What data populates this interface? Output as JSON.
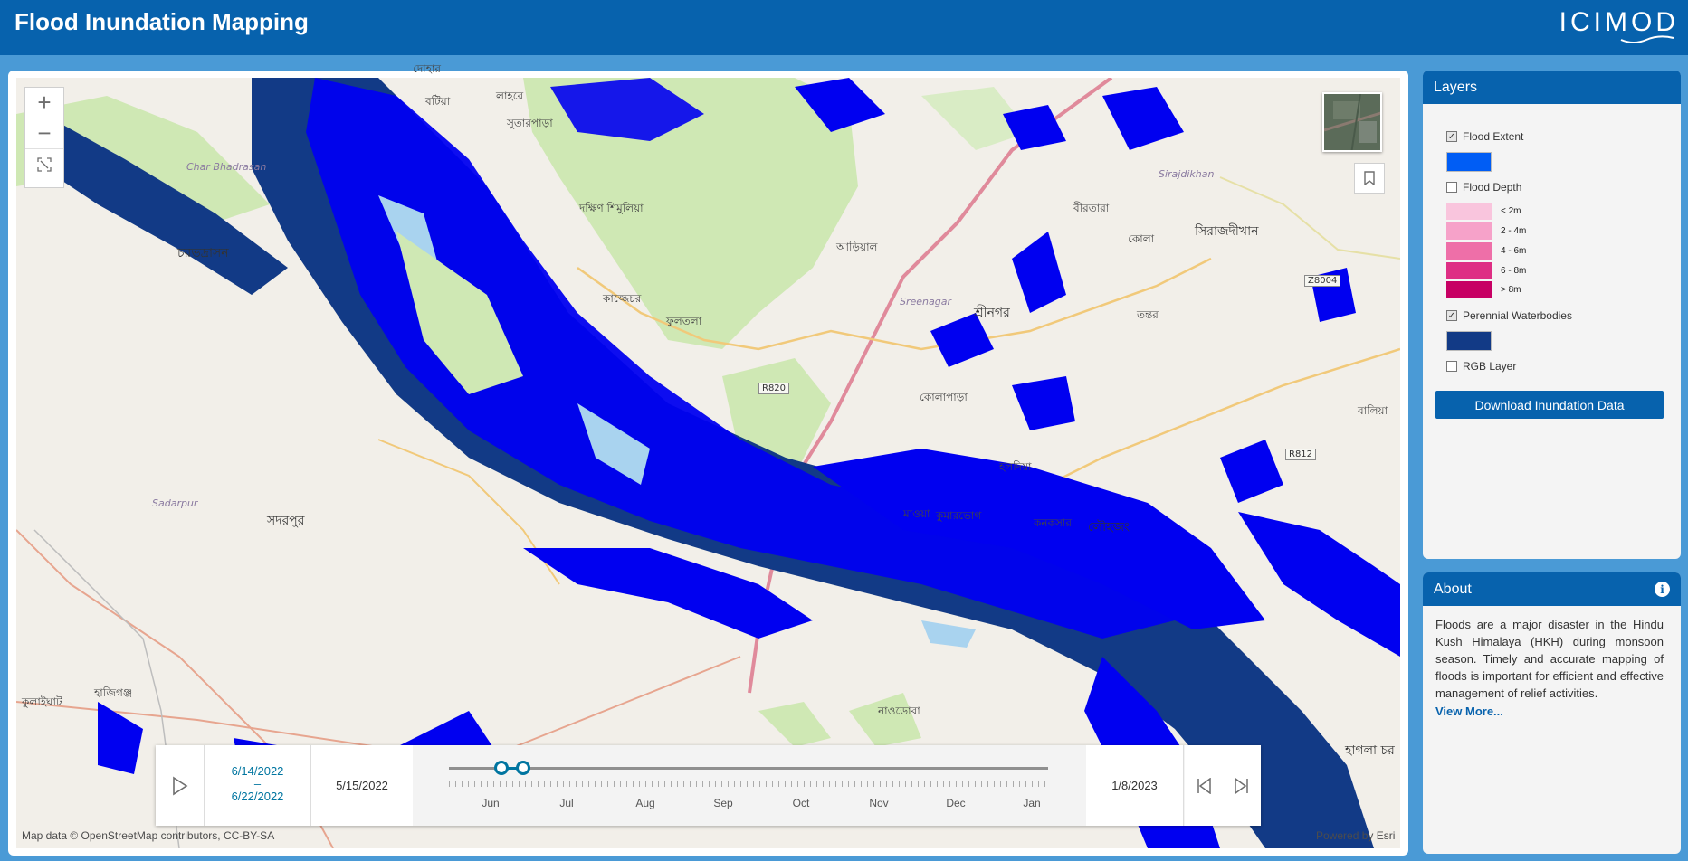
{
  "header": {
    "title": "Flood Inundation Mapping",
    "logo_text": "ICIMOD"
  },
  "map": {
    "attribution": "Map data © OpenStreetMap contributors, CC-BY-SA",
    "powered_by": "Powered by Esri",
    "zoom_in": "+",
    "zoom_out": "−",
    "places": [
      {
        "name": "দোহার",
        "big": false
      },
      {
        "name": "বটিয়া",
        "big": false
      },
      {
        "name": "সুতারপাড়া",
        "big": false
      },
      {
        "name": "লাহরে",
        "big": false
      },
      {
        "name": "দক্ষিণ শিমুলিয়া",
        "big": false
      },
      {
        "name": "চরভদ্রাসন",
        "big": true
      },
      {
        "name": "কাজ্জেচর",
        "big": false
      },
      {
        "name": "ফুলতলা",
        "big": false
      },
      {
        "name": "আড়িয়াল",
        "big": false
      },
      {
        "name": "শ্রীনগর",
        "big": true
      },
      {
        "name": "সিরাজদীখান",
        "big": true
      },
      {
        "name": "বীরতারা",
        "big": false
      },
      {
        "name": "কোলা",
        "big": false
      },
      {
        "name": "তন্তর",
        "big": false
      },
      {
        "name": "কোলাপাড়া",
        "big": false
      },
      {
        "name": "হলদিয়া",
        "big": false
      },
      {
        "name": "সদরপুর",
        "big": true
      },
      {
        "name": "লৌহজং",
        "big": true
      },
      {
        "name": "কনকসার",
        "big": false
      },
      {
        "name": "মাওয়া",
        "big": false
      },
      {
        "name": "কুমারভোগ",
        "big": false
      },
      {
        "name": "হাজিগঞ্জ",
        "big": false
      },
      {
        "name": "নাওডোবা",
        "big": false
      },
      {
        "name": "হাগলা চর",
        "big": true
      },
      {
        "name": "কুলাইঘাট",
        "big": false
      },
      {
        "name": "বালিয়া",
        "big": false
      }
    ],
    "italic_places": [
      "Char Bhadrasan",
      "Sirajdikhan",
      "Sreenagar",
      "Sadarpur"
    ],
    "roads": [
      "R820",
      "R812",
      "Z8004"
    ]
  },
  "timeslider": {
    "range_start": "6/14/2022",
    "range_sep": "–",
    "range_end": "6/22/2022",
    "min_date": "5/15/2022",
    "max_date": "1/8/2023",
    "months": [
      "Jun",
      "Jul",
      "Aug",
      "Sep",
      "Oct",
      "Nov",
      "Dec",
      "Jan"
    ]
  },
  "layers_panel": {
    "title": "Layers",
    "items": [
      {
        "label": "Flood Extent",
        "checked": true,
        "color": "#005df5"
      },
      {
        "label": "Flood Depth",
        "checked": false
      },
      {
        "label": "Perennial Waterbodies",
        "checked": true,
        "color": "#123a86"
      },
      {
        "label": "RGB Layer",
        "checked": false
      }
    ],
    "depth_legend": [
      {
        "label": "< 2m",
        "color": "#f9c5dd"
      },
      {
        "label": "2 - 4m",
        "color": "#f6a2c9"
      },
      {
        "label": "4 - 6m",
        "color": "#ee6fa8"
      },
      {
        "label": "6 - 8m",
        "color": "#de2e84"
      },
      {
        "label": "> 8m",
        "color": "#c70064"
      }
    ],
    "download_label": "Download Inundation Data"
  },
  "about_panel": {
    "title": "About",
    "text": "Floods are a major disaster in the Hindu Kush Himalaya (HKH) during monsoon season. Timely and accurate mapping of floods is important for efficient and effective management of relief activities.",
    "view_more": "View More..."
  },
  "colors": {
    "header": "#0762ad",
    "flood_extent": "#0000f0",
    "perennial": "#123a86",
    "land": "#f2efe9",
    "park": "#cfe8b4"
  }
}
